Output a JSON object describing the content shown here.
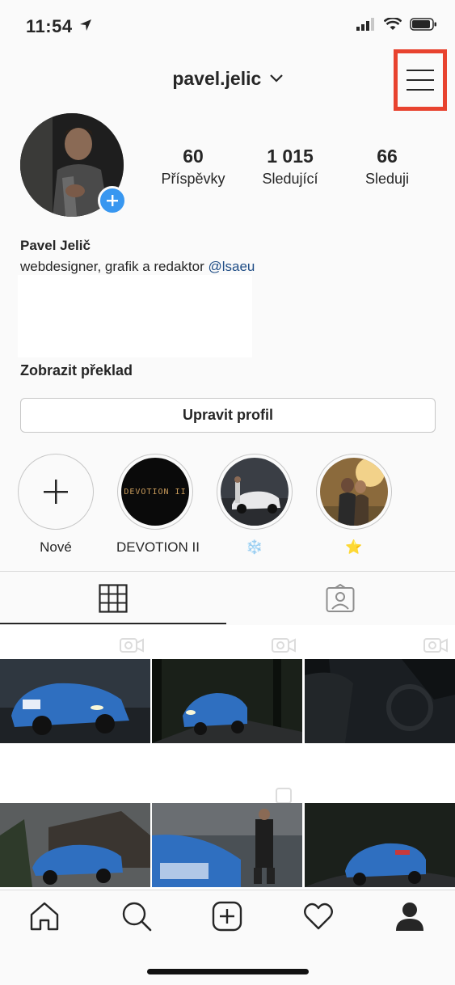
{
  "status": {
    "time": "11:54"
  },
  "header": {
    "username": "pavel.jelic"
  },
  "profile": {
    "stats": [
      {
        "value": "60",
        "label": "Příspěvky"
      },
      {
        "value": "1 015",
        "label": "Sledující"
      },
      {
        "value": "66",
        "label": "Sleduji"
      }
    ],
    "name": "Pavel Jelič",
    "bio": "webdesigner, grafik a redaktor ",
    "mention": "@lsaeu",
    "translate": "Zobrazit překlad",
    "edit_button": "Upravit profil"
  },
  "highlights": [
    {
      "label": "Nové"
    },
    {
      "label": "DEVOTION II",
      "cover_text": "DEVOTION II"
    },
    {
      "label": "❄️"
    },
    {
      "label": "⭐"
    }
  ],
  "tabs": [
    "grid-icon",
    "tagged-icon"
  ],
  "nav": [
    "home-icon",
    "search-icon",
    "add-post-icon",
    "heart-icon",
    "profile-icon"
  ],
  "colors": {
    "accent": "#3897f0",
    "highlight_box": "#e8432f"
  }
}
